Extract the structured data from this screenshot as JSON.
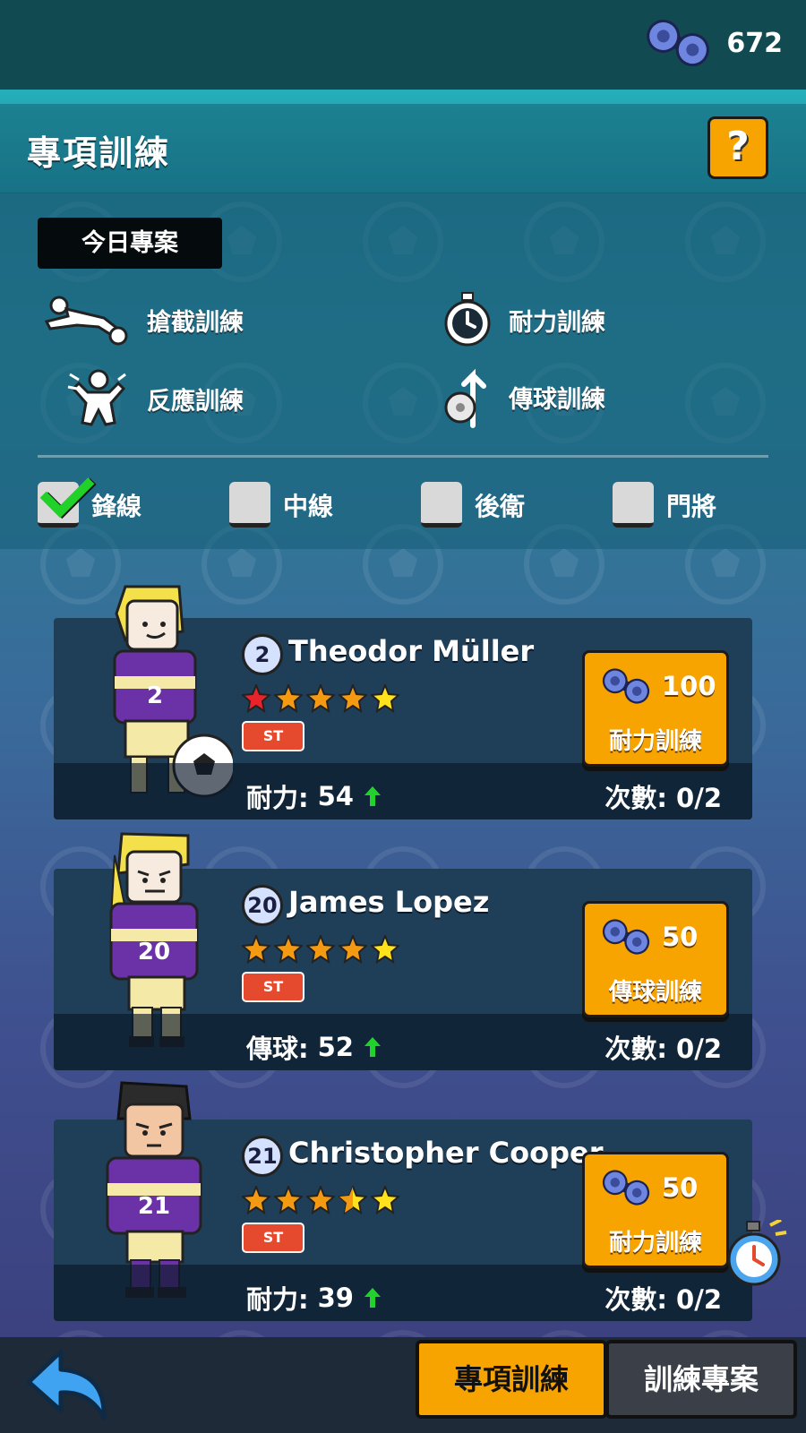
{
  "currency": {
    "icon": "dumbbell-icon",
    "value": "672"
  },
  "header": {
    "title": "專項訓練",
    "help_label": "?"
  },
  "today": {
    "label": "今日專案",
    "projects": [
      {
        "icon": "tackle-icon",
        "label": "搶截訓練"
      },
      {
        "icon": "stopwatch-icon",
        "label": "耐力訓練"
      },
      {
        "icon": "reaction-icon",
        "label": "反應訓練"
      },
      {
        "icon": "pass-icon",
        "label": "傳球訓練"
      }
    ]
  },
  "filters": [
    {
      "label": "鋒線",
      "checked": true
    },
    {
      "label": "中線",
      "checked": false
    },
    {
      "label": "後衛",
      "checked": false
    },
    {
      "label": "門將",
      "checked": false
    }
  ],
  "players": [
    {
      "number": "2",
      "name": "Theodor Müller",
      "stars": 5,
      "first_star_color": "#e8232a",
      "position": "ST",
      "stat_label": "耐力:",
      "stat_value": "54",
      "cost": "100",
      "button_label": "耐力訓練",
      "count_label": "次數:",
      "count_value": "0/2",
      "hair": "#f4e04a",
      "skin": "#f7eadf"
    },
    {
      "number": "20",
      "name": "James Lopez",
      "stars": 5,
      "first_star_color": "#f39a12",
      "position": "ST",
      "stat_label": "傳球:",
      "stat_value": "52",
      "cost": "50",
      "button_label": "傳球訓練",
      "count_label": "次數:",
      "count_value": "0/2",
      "hair": "#f4e04a",
      "skin": "#f7eadf"
    },
    {
      "number": "21",
      "name": "Christopher Cooper",
      "stars": 4.5,
      "first_star_color": "#f39a12",
      "position": "ST",
      "stat_label": "耐力:",
      "stat_value": "39",
      "cost": "50",
      "button_label": "耐力訓練",
      "count_label": "次數:",
      "count_value": "0/2",
      "hair": "#2b2b2b",
      "skin": "#f3c6a3"
    }
  ],
  "bottom": {
    "back_icon": "back-arrow-icon",
    "tab_active": "專項訓練",
    "tab_inactive": "訓練專案"
  },
  "colors": {
    "accent": "#f7a300",
    "check": "#22d02a",
    "position_badge": "#e64a2e"
  }
}
